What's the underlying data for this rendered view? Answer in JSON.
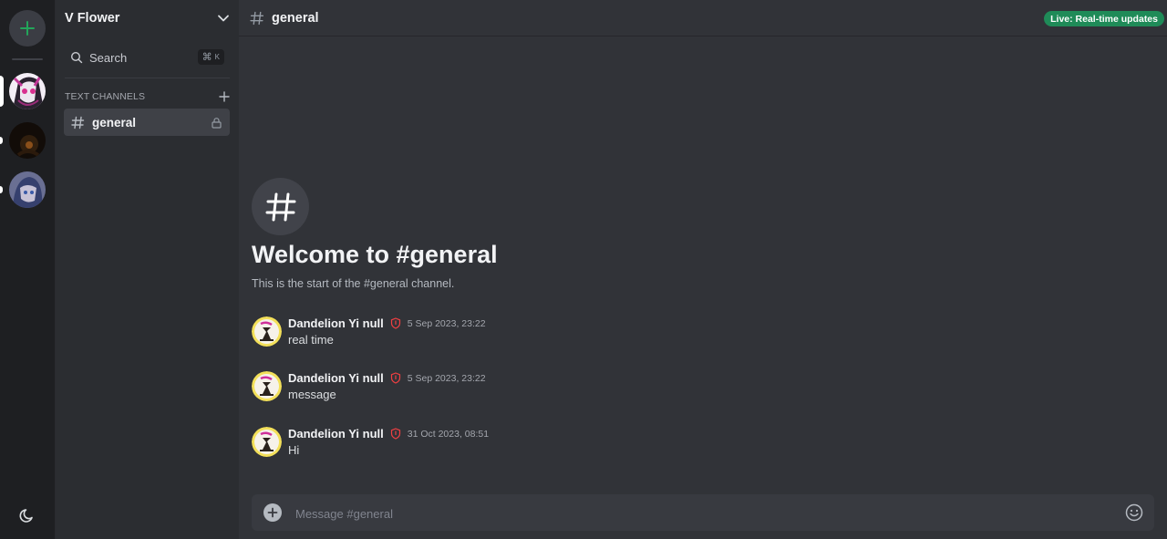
{
  "server": {
    "name": "V Flower",
    "search_label": "Search",
    "search_shortcut_symbol": "⌘",
    "search_shortcut_key": "K"
  },
  "sidebar": {
    "section_title": "TEXT CHANNELS",
    "channels": [
      {
        "name": "general",
        "locked": true,
        "active": true
      }
    ]
  },
  "header": {
    "channel_name": "general",
    "live_badge": "Live: Real-time updates"
  },
  "welcome": {
    "title": "Welcome to #general",
    "subtitle": "This is the start of the #general channel."
  },
  "messages": [
    {
      "author": "Dandelion Yi null",
      "time": "5 Sep 2023, 23:22",
      "text": "real time"
    },
    {
      "author": "Dandelion Yi null",
      "time": "5 Sep 2023, 23:22",
      "text": "message"
    },
    {
      "author": "Dandelion Yi null",
      "time": "31 Oct 2023, 08:51",
      "text": "Hi"
    }
  ],
  "composer": {
    "placeholder": "Message #general"
  },
  "colors": {
    "accent_green": "#23a55a",
    "live_badge": "#1f8b58",
    "moderator_shield": "#f23f42",
    "background": "#313338",
    "sidebar": "#2b2d31",
    "rail": "#1e1f22"
  },
  "icons": {
    "add_server": "plus-icon",
    "theme": "moon-icon",
    "server_menu": "chevron-down-icon",
    "search": "search-icon",
    "add_channel": "plus-icon",
    "channel": "hash-icon",
    "lock": "lock-icon",
    "moderator": "shield-icon",
    "attach": "plus-circle-icon",
    "emoji": "smile-icon"
  }
}
